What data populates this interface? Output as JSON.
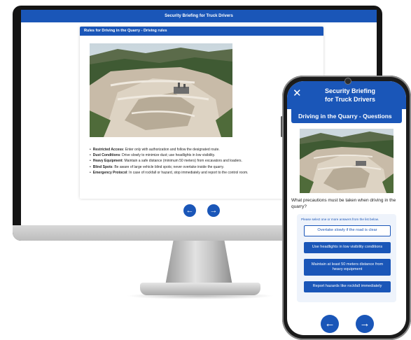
{
  "desktop": {
    "header_title": "Security Briefing for Truck Drivers",
    "card_title": "Rules for Driving in the Quarry - Driving rules",
    "rules": [
      {
        "term": "Restricted Access",
        "text": ": Enter only with authorization and follow the designated route."
      },
      {
        "term": "Dust Conditions",
        "text": ": Drive slowly to minimize dust; use headlights in low visibility."
      },
      {
        "term": "Heavy Equipment",
        "text": ": Maintain a safe distance (minimum 50 meters) from excavators and loaders."
      },
      {
        "term": "Blind Spots",
        "text": ": Be aware of large vehicle blind spots; never overtake inside the quarry."
      },
      {
        "term": "Emergency Protocol",
        "text": ": In case of rockfall or hazard, stop immediately and report to the control room."
      }
    ],
    "prev_icon": "←",
    "next_icon": "→"
  },
  "phone": {
    "close_icon": "✕",
    "header_title_line1": "Security Briefing",
    "header_title_line2": "for Truck Drivers",
    "section_title": "Driving in the Quarry - Questions",
    "question": "What precautions must be taken when driving in the quarry?",
    "instruction": "Please select one or more answers from the list below.",
    "answers": [
      "Overtake slowly if the road is clear",
      "Use headlights in low visibility conditions",
      "Maintain at least 50 meters distance from heavy equipment",
      "Report hazards like rockfall immediately"
    ],
    "prev_icon": "←",
    "next_icon": "→"
  },
  "colors": {
    "brand_blue": "#1a56b8"
  }
}
